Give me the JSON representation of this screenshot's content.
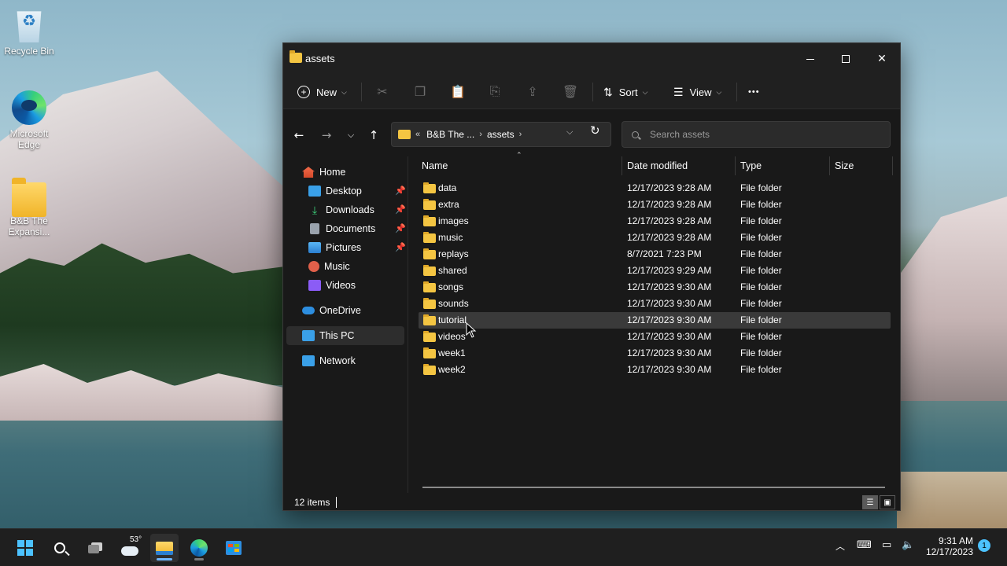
{
  "desktop": {
    "icons": [
      {
        "label": "Recycle Bin"
      },
      {
        "label": "Microsoft Edge"
      },
      {
        "label": "B&B The Expansi..."
      }
    ]
  },
  "window": {
    "title": "assets",
    "toolbar": {
      "new_label": "New",
      "sort_label": "Sort",
      "view_label": "View",
      "more_label": "•••"
    },
    "address": {
      "overflow": "«",
      "segments": [
        "B&B The ...",
        "assets"
      ]
    },
    "search": {
      "placeholder": "Search assets"
    },
    "nav_pane": {
      "items": [
        {
          "label": "Home"
        },
        {
          "label": "Desktop"
        },
        {
          "label": "Downloads"
        },
        {
          "label": "Documents"
        },
        {
          "label": "Pictures"
        },
        {
          "label": "Music"
        },
        {
          "label": "Videos"
        },
        {
          "label": "OneDrive"
        },
        {
          "label": "This PC"
        },
        {
          "label": "Network"
        }
      ]
    },
    "columns": {
      "name": "Name",
      "date": "Date modified",
      "type": "Type",
      "size": "Size"
    },
    "files": [
      {
        "name": "data",
        "date": "12/17/2023 9:28 AM",
        "type": "File folder"
      },
      {
        "name": "extra",
        "date": "12/17/2023 9:28 AM",
        "type": "File folder"
      },
      {
        "name": "images",
        "date": "12/17/2023 9:28 AM",
        "type": "File folder"
      },
      {
        "name": "music",
        "date": "12/17/2023 9:28 AM",
        "type": "File folder"
      },
      {
        "name": "replays",
        "date": "8/7/2021 7:23 PM",
        "type": "File folder"
      },
      {
        "name": "shared",
        "date": "12/17/2023 9:29 AM",
        "type": "File folder"
      },
      {
        "name": "songs",
        "date": "12/17/2023 9:30 AM",
        "type": "File folder"
      },
      {
        "name": "sounds",
        "date": "12/17/2023 9:30 AM",
        "type": "File folder"
      },
      {
        "name": "tutorial",
        "date": "12/17/2023 9:30 AM",
        "type": "File folder"
      },
      {
        "name": "videos",
        "date": "12/17/2023 9:30 AM",
        "type": "File folder"
      },
      {
        "name": "week1",
        "date": "12/17/2023 9:30 AM",
        "type": "File folder"
      },
      {
        "name": "week2",
        "date": "12/17/2023 9:30 AM",
        "type": "File folder"
      }
    ],
    "status": {
      "count": "12 items"
    }
  },
  "taskbar": {
    "weather_temp": "53°",
    "time": "9:31 AM",
    "date": "12/17/2023",
    "notifications": "1"
  },
  "colors": {
    "accent": "#4cc2ff",
    "folder": "#f4c542",
    "window_bg": "#191919",
    "hover_row": "#3a3a3a"
  }
}
